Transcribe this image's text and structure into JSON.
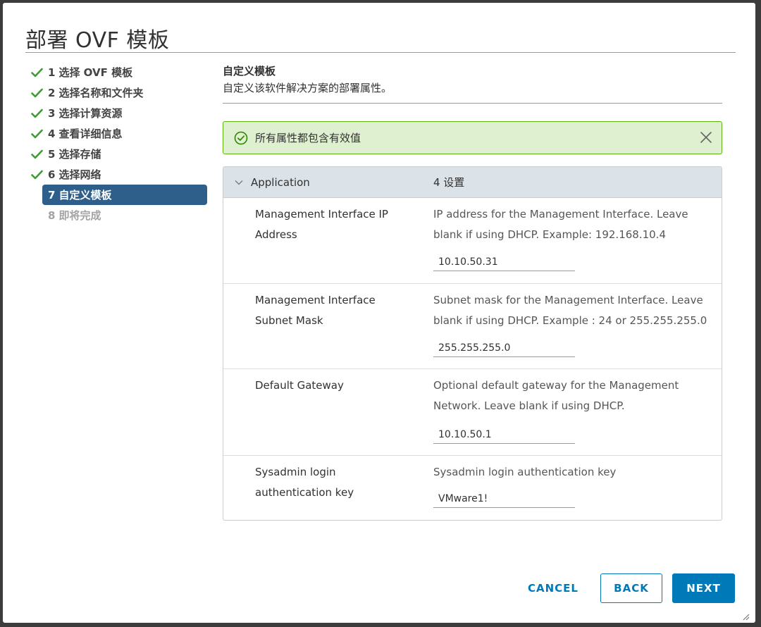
{
  "dialog": {
    "title": "部署 OVF 模板"
  },
  "steps": [
    {
      "num": "1",
      "label": "选择 OVF 模板",
      "state": "done"
    },
    {
      "num": "2",
      "label": "选择名称和文件夹",
      "state": "done"
    },
    {
      "num": "3",
      "label": "选择计算资源",
      "state": "done"
    },
    {
      "num": "4",
      "label": "查看详细信息",
      "state": "done"
    },
    {
      "num": "5",
      "label": "选择存储",
      "state": "done"
    },
    {
      "num": "6",
      "label": "选择网络",
      "state": "done"
    },
    {
      "num": "7",
      "label": "自定义模板",
      "state": "active"
    },
    {
      "num": "8",
      "label": "即将完成",
      "state": "disabled"
    }
  ],
  "content": {
    "title": "自定义模板",
    "description": "自定义该软件解决方案的部署属性。"
  },
  "alert": {
    "text": "所有属性都包含有效值"
  },
  "grid": {
    "group_name": "Application",
    "group_count": "4 设置",
    "rows": [
      {
        "label_line1": "Management Interface IP",
        "label_line2": "Address",
        "desc_line1": "IP address for the Management Interface. Leave",
        "desc_line2": "blank if using DHCP. Example: 192.168.10.4",
        "value": "10.10.50.31"
      },
      {
        "label_line1": "Management Interface",
        "label_line2": "Subnet Mask",
        "desc_line1": "Subnet mask for the Management Interface. Leave",
        "desc_line2": "blank if using DHCP. Example : 24 or 255.255.255.0",
        "value": "255.255.255.0"
      },
      {
        "label_line1": "Default Gateway",
        "label_line2": "",
        "desc_line1": "Optional default gateway for the Management",
        "desc_line2": "Network. Leave blank if using DHCP.",
        "value": "10.10.50.1"
      },
      {
        "label_line1": "Sysadmin login",
        "label_line2": "authentication key",
        "desc_line1": "Sysadmin login authentication key",
        "desc_line2": "",
        "value": "VMware1!"
      }
    ]
  },
  "footer": {
    "cancel_label": "CANCEL",
    "back_label": "BACK",
    "next_label": "NEXT"
  },
  "colors": {
    "accent": "#0079b8",
    "active_step": "#2e5e8a",
    "success_green": "#60b515",
    "alert_bg": "#dff0d0"
  }
}
